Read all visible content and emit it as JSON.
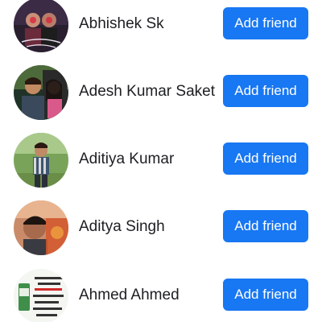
{
  "friend_suggestions": [
    {
      "name": "Abhishek Sk",
      "button_label": "Add friend",
      "avatar_icon": "profile-photo"
    },
    {
      "name": "Adesh Kumar Saket",
      "button_label": "Add friend",
      "avatar_icon": "profile-photo"
    },
    {
      "name": "Aditiya Kumar",
      "button_label": "Add friend",
      "avatar_icon": "profile-photo"
    },
    {
      "name": "Aditya Singh",
      "button_label": "Add friend",
      "avatar_icon": "profile-photo"
    },
    {
      "name": "Ahmed Ahmed",
      "button_label": "Add friend",
      "avatar_icon": "profile-photo"
    }
  ],
  "colors": {
    "button_bg": "#1877f2",
    "button_text": "#ffffff",
    "name_text": "#1c1e21"
  }
}
